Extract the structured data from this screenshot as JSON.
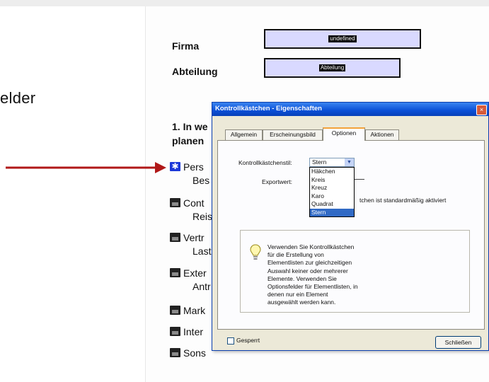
{
  "slide": {
    "partial_text": "elder"
  },
  "form": {
    "firma_label": "Firma",
    "firma_value": "undefined",
    "abteilung_label": "Abteilung",
    "abteilung_value": "Abteilung",
    "section_line1": "1. In we",
    "section_line2": "planen",
    "rows": [
      {
        "line1": "Pers",
        "line2": "Bes",
        "icon": "star-checkbox-icon"
      },
      {
        "line1": "Cont",
        "line2": "Reis",
        "icon": "checkbox-field-icon"
      },
      {
        "line1": "Vertr",
        "line2": "Last",
        "icon": "checkbox-field-icon"
      },
      {
        "line1": "Exter",
        "line2": "Antr",
        "icon": "checkbox-field-icon"
      },
      {
        "line1": "Mark",
        "line2": "",
        "icon": "checkbox-field-icon"
      },
      {
        "line1": "Inter",
        "line2": "",
        "icon": "checkbox-field-icon"
      },
      {
        "line1": "Sons",
        "line2": "",
        "icon": "checkbox-field-icon"
      }
    ]
  },
  "dialog": {
    "title": "Kontrollkästchen - Eigenschaften",
    "close_glyph": "×",
    "tabs": [
      {
        "label": "Allgemein"
      },
      {
        "label": "Erscheinungsbild"
      },
      {
        "label": "Optionen"
      },
      {
        "label": "Aktionen"
      }
    ],
    "active_tab": "Optionen",
    "style_label": "Kontrollkästchenstil:",
    "style_value": "Stern",
    "export_label": "Exportwert:",
    "default_text": "tchen ist standardmäßig aktiviert",
    "style_options": [
      "Häkchen",
      "Kreis",
      "Kreuz",
      "Karo",
      "Quadrat",
      "Stern"
    ],
    "selected_option": "Stern",
    "info_text": "Verwenden Sie Kontrollkästchen für die Erstellung von Elementlisten zur gleichzeitigen Auswahl keiner oder mehrerer Elemente. Verwenden Sie Optionsfelder für Elementlisten, in denen nur ein Element ausgewählt werden kann.",
    "locked_label": "Gesperrt",
    "close_button": "Schließen"
  },
  "colors": {
    "arrow": "#b01818",
    "field_fill": "#d9d9ff",
    "title_bar": "#0a4fd6",
    "selection": "#316ac5",
    "star_checkbox": "#1c38d8"
  }
}
